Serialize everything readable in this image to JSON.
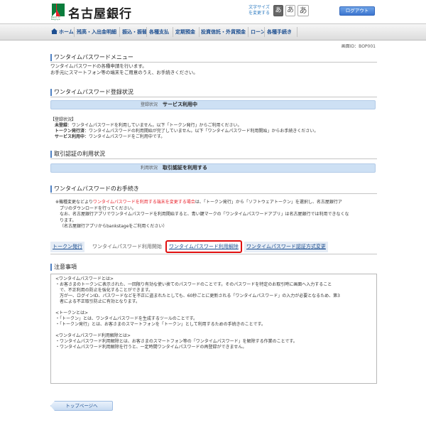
{
  "header": {
    "bank_name": "名古屋銀行",
    "logo_small": "Bank of Nagoya",
    "fontsize_label": "文字サイズを変更する",
    "fontsize_buttons": [
      "あ",
      "あ",
      "あ"
    ],
    "logout": "ログアウト"
  },
  "nav": {
    "items": [
      "ホーム",
      "残高・入出金明細",
      "振込・振替",
      "各種支払",
      "定期預金",
      "投資信託・外貨預金",
      "ローン",
      "各種手続き"
    ]
  },
  "screen_id": "画面ID：BOP001",
  "menu": {
    "title": "ワンタイムパスワードメニュー",
    "intro_1": "ワンタイムパスワードの各種申請を行います。",
    "intro_2": "お手元にスマートフォン等の端末をご用意のうえ、お手続きください。"
  },
  "registration": {
    "title": "ワンタイムパスワード登録状況",
    "status_label": "登録状況",
    "status_value": "サービス利用中",
    "legend_header": "【登録状況】",
    "legend": [
      {
        "term": "未登録",
        "desc": "：ワンタイムパスワードを利用していません。以下「トークン発行」からご利用ください。"
      },
      {
        "term": "トークン発行済",
        "desc": "：ワンタイムパスワードの利用開始が完了していません。以下「ワンタイムパスワード利用開始」からお手続きください。"
      },
      {
        "term": "サービス利用中",
        "desc": "：ワンタイムパスワードをご利用中です。"
      }
    ]
  },
  "auth": {
    "title": "取引認証の利用状況",
    "status_label": "利用状況",
    "status_value": "取引認証を利用する"
  },
  "procedure": {
    "title": "ワンタイムパスワードのお手続き",
    "note_prefix": "※機種変更などより",
    "note_red": "ワンタイムパスワードを利用する端末を変更する場合",
    "note_suffix": "は、「トークン発行」から「ソフトウェアトークン」を選択し、名古屋銀行ア",
    "note_line2": "プリのダウンロードを行ってください。",
    "note_line3": "なお、名古屋銀行アプリでワンタイムパスワードを利用開始すると、青い鍵マークの「ワンタイムパスワードアプリ」は名古屋銀行では利用できなくな",
    "note_line4": "ります。",
    "note_line5": "（名古屋銀行アプリからbankstageをご利用ください）"
  },
  "tabs": [
    {
      "label": "トークン発行"
    },
    {
      "label": "ワンタイムパスワード利用開始"
    },
    {
      "label": "ワンタイムパスワード利用解除"
    },
    {
      "label": "ワンタイムパスワード認証方式変更"
    }
  ],
  "notice": {
    "title": "注意事項",
    "text": "<ワンタイムパスワードとは>\n・お客さまのトークンに表示された、一回限り有効な使い捨てのパスワードのことです。そのパスワードを特定のお取引時に画面へ入力すること\n　で、不正利用の防止を強化することができます。\n　万が一、ログインID、パスワードなどを不正に盗まれたとしても、60秒ごとに更新される「ワンタイムパスワード」の入力が必要となるため、第3\n　者による不正取引防止に有効となります。\n\n<トークンとは>\n・「トークン」とは、ワンタイムパスワードを生成するツールのことです。\n・「トークン発行」とは、お客さまのスマートフォンを「トークン」として利用するための手続きのことです。\n\n<ワンタイムパスワード利用解除とは>\n・ワンタイムパスワード利用解除とは、お客さまのスマートフォン等の「ワンタイムパスワード」を解除する作業のことです。\n・ワンタイムパスワード利用解除を行うと、一定時間ワンタイムパスワードの再登録ができません。"
  },
  "top_button": "トップページへ",
  "colors": {
    "accent": "#1d4f91",
    "status_bar": "#cde0f4",
    "highlight_red": "#e01010",
    "logo_green": "#0a7d3c"
  }
}
